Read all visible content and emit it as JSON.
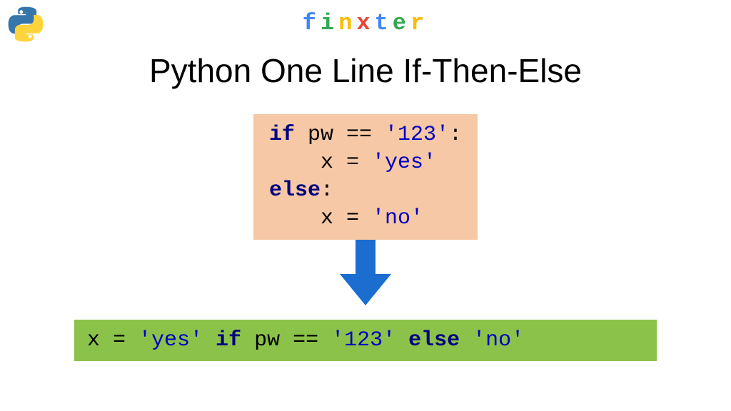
{
  "logo": {
    "chars": [
      {
        "c": "f",
        "color": "#4285f4"
      },
      {
        "c": "i",
        "color": "#34a853"
      },
      {
        "c": "n",
        "color": "#fbbc05"
      },
      {
        "c": "x",
        "color": "#ea4335"
      },
      {
        "c": "t",
        "color": "#4285f4"
      },
      {
        "c": "e",
        "color": "#34a853"
      },
      {
        "c": "r",
        "color": "#fbbc05"
      }
    ]
  },
  "title": "Python One Line If-Then-Else",
  "code1": {
    "line1_kw": "if",
    "line1_rest": " pw == ",
    "line1_str": "'123'",
    "line1_colon": ":",
    "line2_indent": "    x = ",
    "line2_str": "'yes'",
    "line3_kw": "else",
    "line3_colon": ":",
    "line4_indent": "    x = ",
    "line4_str": "'no'"
  },
  "code2": {
    "p1": "x = ",
    "p2": "'yes'",
    "p3": " ",
    "p4": "if",
    "p5": " pw == ",
    "p6": "'123'",
    "p7": " ",
    "p8": "else",
    "p9": " ",
    "p10": "'no'"
  },
  "colors": {
    "arrow": "#1c6dd0",
    "box1": "#f6c8a5",
    "box2": "#8bc34a",
    "keyword": "#000080",
    "string": "#0000c0"
  }
}
